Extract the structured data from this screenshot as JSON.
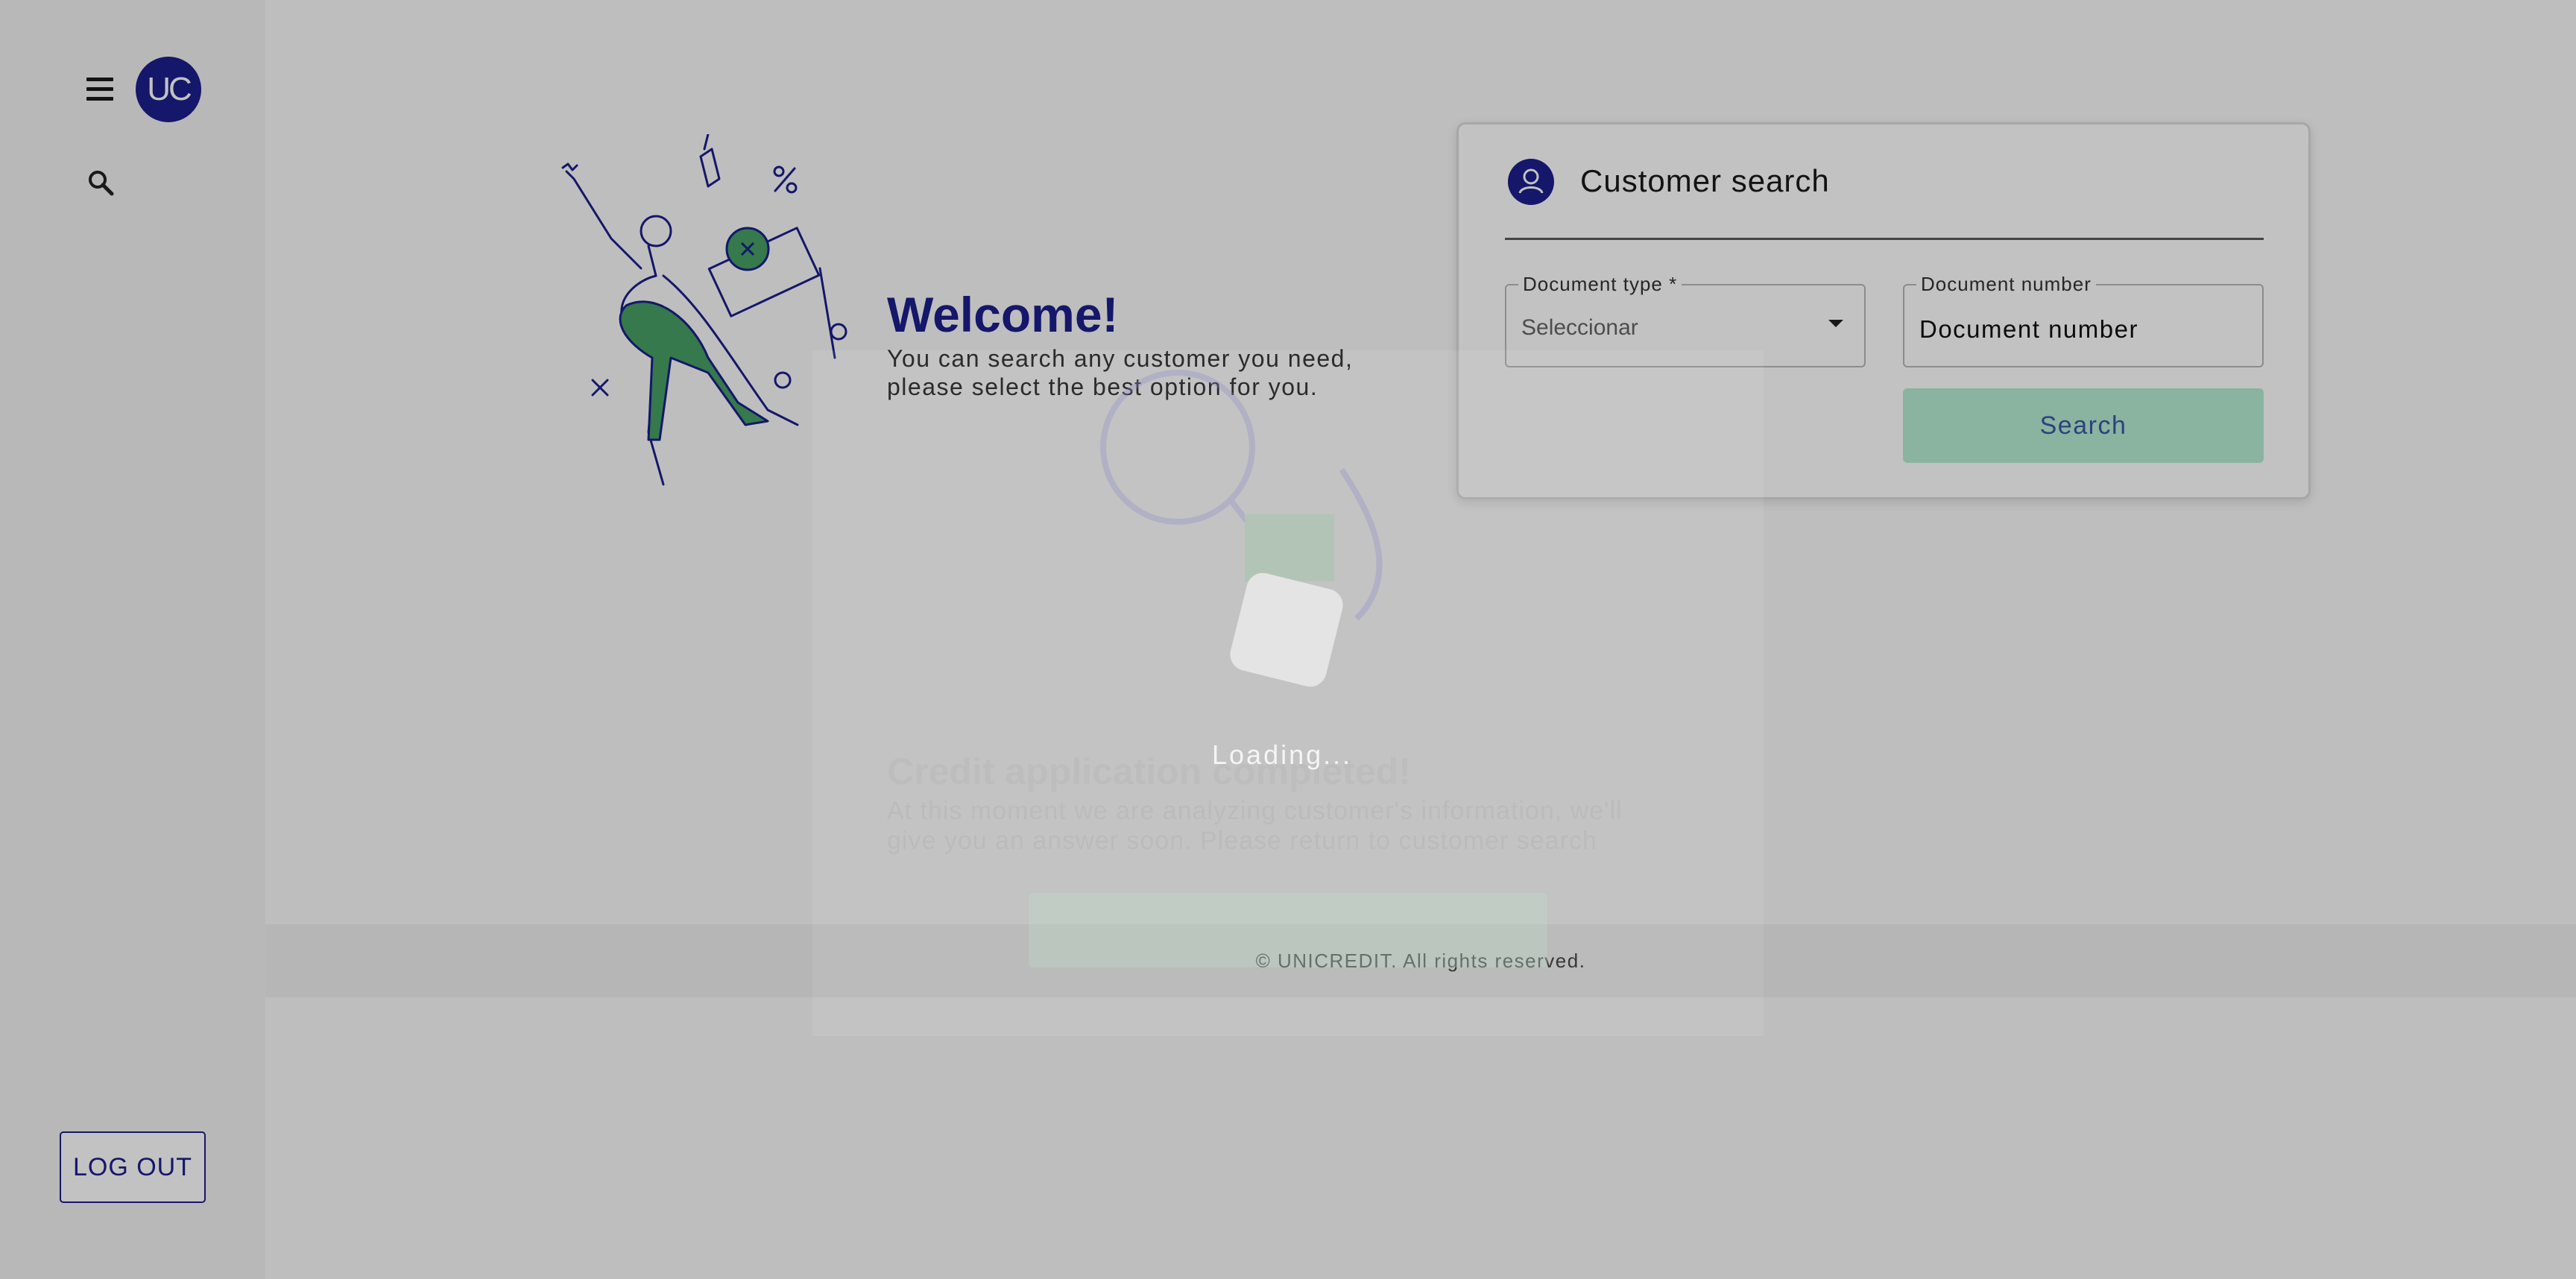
{
  "sidebar": {
    "avatar_text": "UC",
    "logout_label": "LOG OUT"
  },
  "welcome": {
    "title": "Welcome!",
    "text": "You can search any customer you need, please select the best option for you."
  },
  "customer_search": {
    "title": "Customer search",
    "document_type_label": "Document type *",
    "document_type_value": "Seleccionar",
    "document_number_label": "Document number",
    "document_number_value": "Document number",
    "search_label": "Search"
  },
  "footer": {
    "text": "© UNICREDIT. All rights reserved."
  },
  "background_modal": {
    "title": "Credit application completed!",
    "text": "At this moment we are analyzing customer's information, we'll give you an answer soon. Please return to customer search"
  },
  "loading": {
    "text": "Loading..."
  },
  "colors": {
    "brand": "#1b1f8c",
    "accent_green": "#46a064",
    "search_button": "#b6ecd3"
  }
}
